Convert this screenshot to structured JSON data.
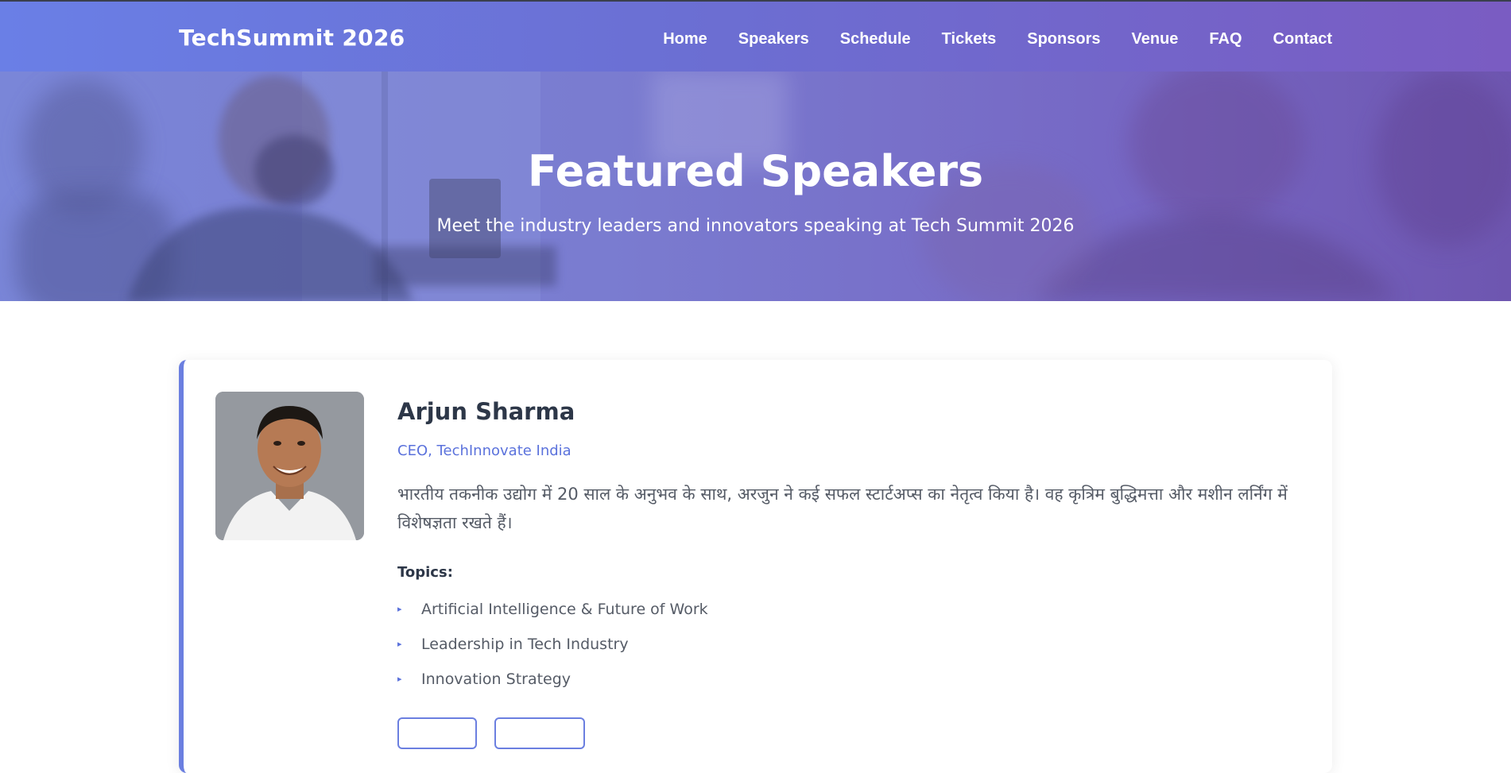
{
  "header": {
    "brand": "TechSummit 2026",
    "nav": [
      "Home",
      "Speakers",
      "Schedule",
      "Tickets",
      "Sponsors",
      "Venue",
      "FAQ",
      "Contact"
    ]
  },
  "hero": {
    "title": "Featured Speakers",
    "subtitle": "Meet the industry leaders and innovators speaking at Tech Summit 2026"
  },
  "speaker": {
    "name": "Arjun Sharma",
    "role": "CEO, TechInnovate India",
    "bio": "भारतीय तकनीक उद्योग में 20 साल के अनुभव के साथ, अरजुन ने कई सफल स्टार्टअप्स का नेतृत्व किया है। वह कृत्रिम बुद्धिमत्ता और मशीन लर्निंग में विशेषज्ञता रखते हैं।",
    "topics_title": "Topics:",
    "topics": [
      "Artificial Intelligence & Future of Work",
      "Leadership in Tech Industry",
      "Innovation Strategy"
    ]
  },
  "colors": {
    "accent": "#6b7fe0",
    "role_text": "#5b72dc",
    "hero_gradient_start": "#7a86d8",
    "hero_gradient_end": "#6e56b0"
  }
}
